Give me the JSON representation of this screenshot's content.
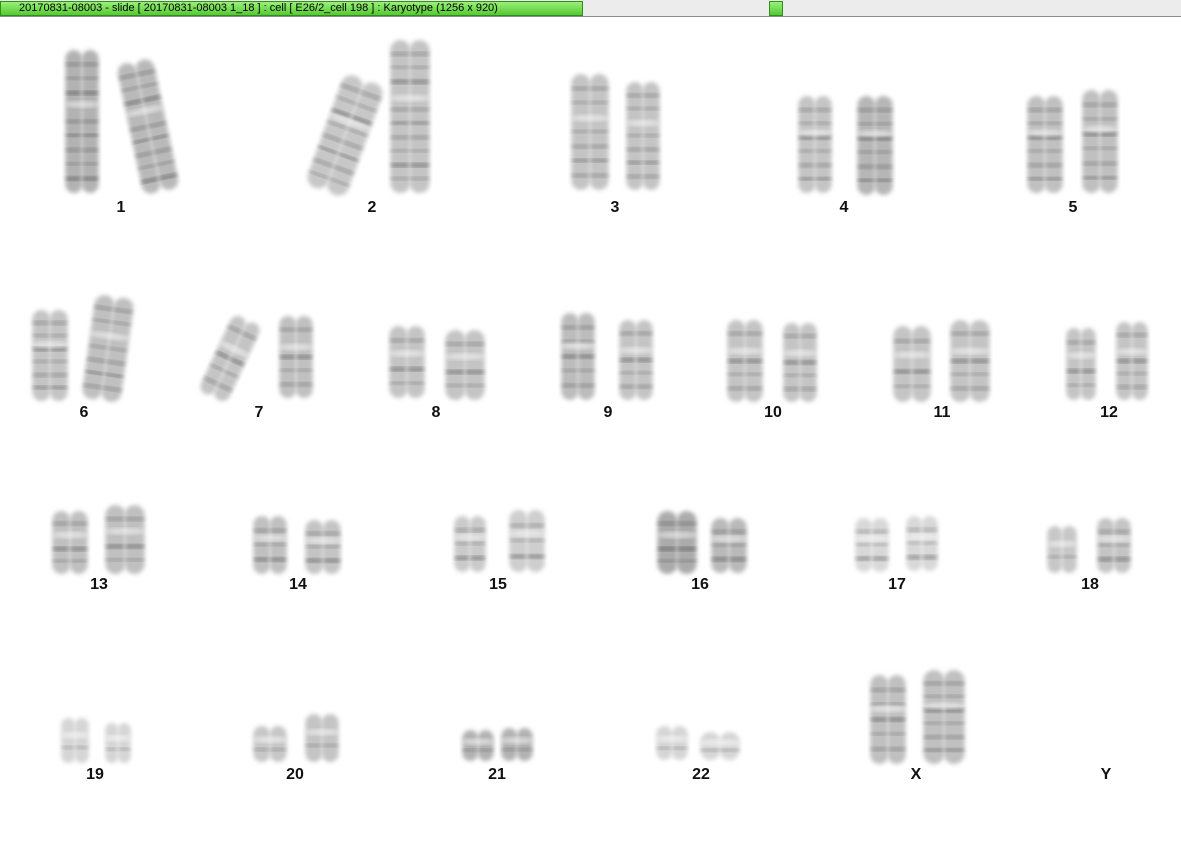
{
  "window": {
    "title": "20170831-08003 - slide [ 20170831-08003 1_18 ] : cell [ E26/2_cell 198 ] : Karyotype  (1256 x 920)"
  },
  "karyotype": {
    "labels": [
      "1",
      "2",
      "3",
      "4",
      "5",
      "6",
      "7",
      "8",
      "9",
      "10",
      "11",
      "12",
      "13",
      "14",
      "15",
      "16",
      "17",
      "18",
      "19",
      "20",
      "21",
      "22",
      "X",
      "Y"
    ]
  }
}
